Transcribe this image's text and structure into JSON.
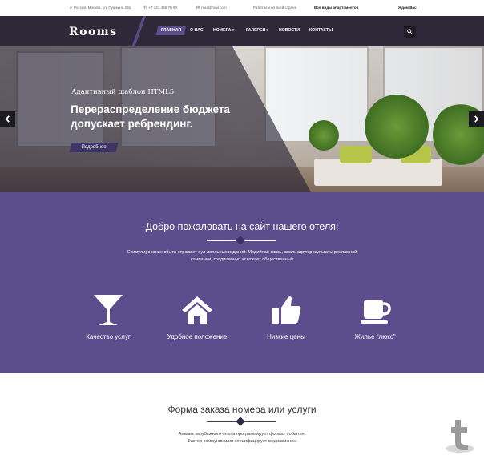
{
  "topbar": {
    "address": "Россия, Москва, ул. Пушкина 23а",
    "phone": "+7 123 456 78 90",
    "email": "mail@mail.com",
    "work_area": "Работаем по всей стране",
    "apartments": "Все виды апартаментов",
    "welcome": "Ждем Вас!"
  },
  "logo": "Rooms",
  "nav": {
    "items": [
      {
        "label": "ГЛАВНАЯ"
      },
      {
        "label": "О НАС"
      },
      {
        "label": "НОМЕРА ▾"
      },
      {
        "label": "ГАЛЕРЕЯ ▾"
      },
      {
        "label": "НОВОСТИ"
      },
      {
        "label": "КОНТАКТЫ"
      }
    ],
    "active_index": 0
  },
  "hero": {
    "subtitle": "Адаптивный шаблон HTML5",
    "title": "Перераспределение бюджета допускает ребрендинг.",
    "button": "Подробнее"
  },
  "welcome": {
    "title": "Добро пожаловать на сайт нашего отеля!",
    "text": "Стимулирование сбыта отражает пул лояльных изданий. Медийная связь, анализируя результаты рекламной кампании, традиционно искажает общественный",
    "features": [
      {
        "label": "Качество услуг",
        "icon": "cocktail-glass-icon"
      },
      {
        "label": "Удобное положение",
        "icon": "house-icon"
      },
      {
        "label": "Низкие цены",
        "icon": "thumbs-up-icon"
      },
      {
        "label": "Жилье \"люкс\"",
        "icon": "coffee-cup-icon"
      }
    ]
  },
  "form_section": {
    "title": "Форма заказа номера или услуги",
    "text_line1": "Анализ зарубежного опыта программирует формат события.",
    "text_line2": "Фактор коммуникации специфицирует медиавизнес."
  },
  "colors": {
    "nav_bg": "#2e2838",
    "accent": "#5a4e8a",
    "welcome_bg": "#5c4e8c"
  }
}
